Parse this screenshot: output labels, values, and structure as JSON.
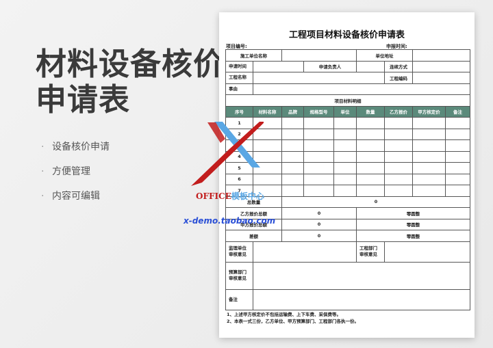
{
  "headline": {
    "line1": "材料设备核价",
    "line2": "申请表"
  },
  "features": [
    "设备核价申请",
    "方便管理",
    "内容可编辑"
  ],
  "document": {
    "title": "工程项目材料设备核价申请表",
    "project_no_label": "项目编号:",
    "report_time_label": "申报时间:",
    "rows": {
      "contractor": "施工单位名称",
      "unit_address": "单位地址",
      "apply_time": "申请时间",
      "applicant": "申请负责人",
      "contact": "连续方式",
      "project_name": "工程名称",
      "project_code": "工程编码",
      "matter": "事由",
      "detail_title": "项目材料明细"
    },
    "columns": [
      "序号",
      "材料名称",
      "品牌",
      "规格型号",
      "单位",
      "数量",
      "乙方报价",
      "甲方核定价",
      "备注"
    ],
    "row_numbers": [
      "1",
      "2",
      "3",
      "4",
      "5",
      "6",
      "7"
    ],
    "total_qty_label": "总数量",
    "total_qty_value": "0",
    "totals": [
      {
        "label": "乙方报价总额",
        "value": "0",
        "round": "零圆整"
      },
      {
        "label": "甲方报价总额",
        "value": "0",
        "round": "零圆整"
      },
      {
        "label": "差额",
        "value": "0",
        "round": "零圆整"
      }
    ],
    "supervision": "监理单位\n审核意见",
    "engineering": "工程部门\n审核意见",
    "budget": "预算部门\n审核意见",
    "remarks": "备注",
    "notes": [
      "1、上述甲方核定价不包括运输费、上下车费、采保费等。",
      "2、本表一式三份，乙方单位、甲方预算部门、工程部门各执一份。"
    ]
  },
  "watermark": {
    "brand": "OFFICE",
    "brand_cn": "模板中心",
    "url": "x-demo.taobao.com"
  },
  "colors": {
    "header_teal": "#5b8a7b",
    "logo_red": "#c21d1d",
    "logo_blue": "#5aa7e4",
    "url_blue": "#2a4fd6"
  }
}
